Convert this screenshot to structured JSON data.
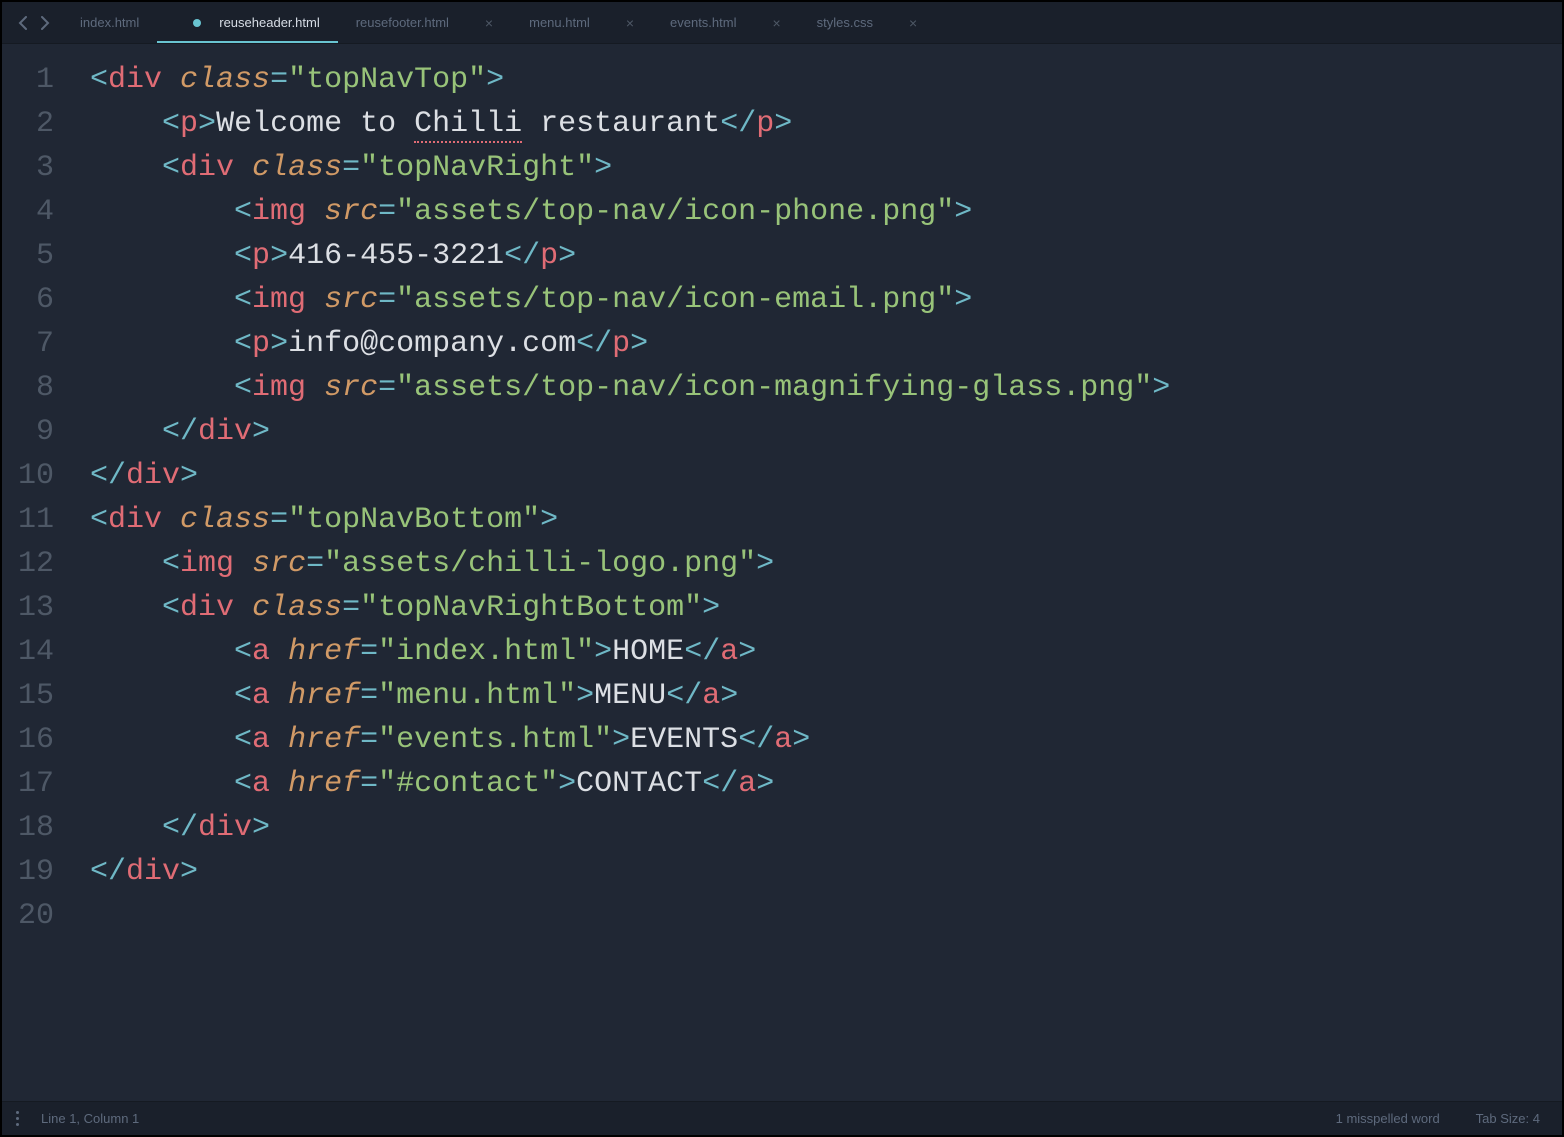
{
  "tabs": [
    {
      "label": "index.html",
      "active": false,
      "dirty": false,
      "noicon": true
    },
    {
      "label": "reuseheader.html",
      "active": true,
      "dirty": true
    },
    {
      "label": "reusefooter.html",
      "active": false,
      "dirty": false
    },
    {
      "label": "menu.html",
      "active": false,
      "dirty": false
    },
    {
      "label": "events.html",
      "active": false,
      "dirty": false
    },
    {
      "label": "styles.css",
      "active": false,
      "dirty": false
    }
  ],
  "line_count": 20,
  "code": {
    "tag_div": "div",
    "tag_p": "p",
    "tag_img": "img",
    "tag_a": "a",
    "attr_class": "class",
    "attr_src": "src",
    "attr_href": "href",
    "str_topNavTop": "\"topNavTop\"",
    "str_topNavRight": "\"topNavRight\"",
    "str_topNavBottom": "\"topNavBottom\"",
    "str_topNavRightBottom": "\"topNavRightBottom\"",
    "str_icon_phone": "\"assets/top-nav/icon-phone.png\"",
    "str_icon_email": "\"assets/top-nav/icon-email.png\"",
    "str_icon_mag": "\"assets/top-nav/icon-magnifying-glass.png\"",
    "str_logo": "\"assets/chilli-logo.png\"",
    "str_href_index": "\"index.html\"",
    "str_href_menu": "\"menu.html\"",
    "str_href_events": "\"events.html\"",
    "str_href_contact": "\"#contact\"",
    "txt_welcome_a": "Welcome to ",
    "txt_welcome_b": "Chilli",
    "txt_welcome_c": " restaurant",
    "txt_phone": "416-455-3221",
    "txt_email": "info@company.com",
    "txt_home": "HOME",
    "txt_menu": "MENU",
    "txt_events": "EVENTS",
    "txt_contact": "CONTACT"
  },
  "status": {
    "cursor": "Line 1, Column 1",
    "spell": "1 misspelled word",
    "tabsize": "Tab Size: 4"
  }
}
